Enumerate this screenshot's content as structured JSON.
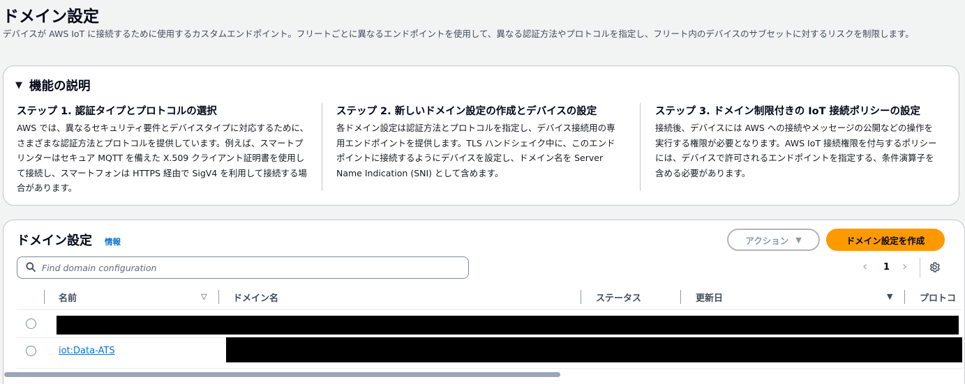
{
  "page": {
    "title": "ドメイン設定",
    "description": "デバイスが AWS IoT に接続するために使用するカスタムエンドポイント。フリートごとに異なるエンドポイントを使用して、異なる認証方法やプロトコルを指定し、フリート内のデバイスのサブセットに対するリスクを制限します。"
  },
  "how_it_works": {
    "title": "機能の説明",
    "steps": [
      {
        "title": "ステップ 1. 認証タイプとプロトコルの選択",
        "body": "AWS では、異なるセキュリティ要件とデバイスタイプに対応するために、さまざまな認証方法とプロトコルを提供しています。例えば、スマートプリンターはセキュア MQTT を備えた X.509 クライアント証明書を使用して接続し、スマートフォンは HTTPS 経由で SigV4 を利用して接続する場合があります。"
      },
      {
        "title": "ステップ 2. 新しいドメイン設定の作成とデバイスの設定",
        "body": "各ドメイン設定は認証方法とプロトコルを指定し、デバイス接続用の専用エンドポイントを提供します。TLS ハンドシェイク中に、このエンドポイントに接続するようにデバイスを設定し、ドメイン名を Server Name Indication (SNI) として含めます。"
      },
      {
        "title": "ステップ 3. ドメイン制限付きの IoT 接続ポリシーの設定",
        "body": "接続後、デバイスには AWS への接続やメッセージの公開などの操作を実行する権限が必要となります。AWS IoT 接続権限を付与するポリシーには、デバイスで許可されるエンドポイントを指定する、条件演算子を含める必要があります。"
      }
    ]
  },
  "table": {
    "title": "ドメイン設定",
    "info_label": "情報",
    "actions_label": "アクション",
    "create_label": "ドメイン設定を作成",
    "search_placeholder": "Find domain configuration",
    "page_number": "1",
    "columns": [
      "名前",
      "ドメイン名",
      "ステータス",
      "更新日",
      "プロトコ"
    ],
    "rows": [
      {
        "name": ""
      },
      {
        "name": "iot:Data-ATS"
      }
    ]
  },
  "colors": {
    "primary_button": "#ff9900",
    "link": "#0972d3",
    "background": "#f2f3f3"
  }
}
